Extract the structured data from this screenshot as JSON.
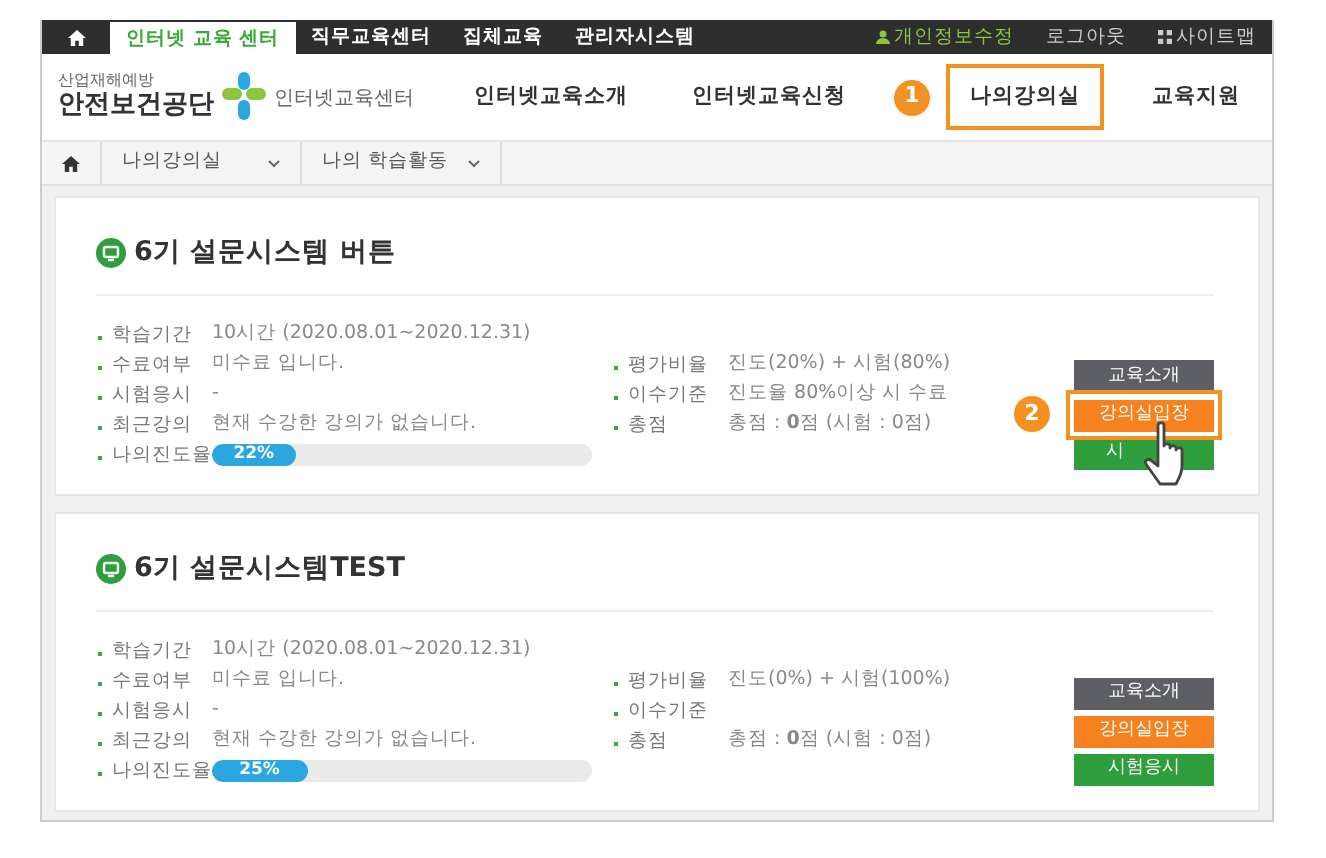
{
  "top_bar": {
    "tabs": [
      {
        "label": "인터넷 교육 센터",
        "selected": true
      },
      {
        "label": "직무교육센터",
        "selected": false
      },
      {
        "label": "집체교육",
        "selected": false
      },
      {
        "label": "관리자시스템",
        "selected": false
      }
    ],
    "links": [
      {
        "label": "개인정보수정",
        "kind": "user"
      },
      {
        "label": "로그아웃",
        "kind": "plain"
      },
      {
        "label": "사이트맵",
        "kind": "sitemap"
      }
    ]
  },
  "header": {
    "logo": {
      "tagline": "산업재해예방",
      "name": "안전보건공단",
      "subtitle": "인터넷교육센터"
    },
    "nav": [
      {
        "label": "인터넷교육소개"
      },
      {
        "label": "인터넷교육신청"
      },
      {
        "label": "나의강의실",
        "callout": "1"
      },
      {
        "label": "교육지원"
      }
    ]
  },
  "breadcrumb": [
    {
      "label": "나의강의실"
    },
    {
      "label": "나의 학습활동"
    }
  ],
  "courses": [
    {
      "title": "6기 설문시스템 버튼",
      "pointer_cursor": true,
      "details_left": [
        {
          "label": "학습기간",
          "value": "10시간 (2020.08.01~2020.12.31)"
        },
        {
          "label": "수료여부",
          "value": "미수료 입니다."
        },
        {
          "label": "시험응시",
          "value": "-"
        },
        {
          "label": "최근강의",
          "value": "현재 수강한 강의가 없습니다."
        },
        {
          "label": "나의진도율",
          "kind": "progress",
          "level": 0.22,
          "reading": "22%"
        }
      ],
      "details_right": [
        {
          "label": "평가비율",
          "value": "진도(20%) + 시험(80%)"
        },
        {
          "label": "이수기준",
          "value": "진도율 80%이상 시 수료"
        },
        {
          "label": "총점",
          "value": "총점 : **0**점 (시험 : 0점)"
        }
      ],
      "buttons": [
        {
          "label": "교육소개",
          "kind": "intro"
        },
        {
          "label": "강의실입장",
          "kind": "enter",
          "callout": "2"
        },
        {
          "label": "시",
          "kind": "exam"
        }
      ]
    },
    {
      "title": "6기 설문시스템TEST",
      "pointer_cursor": false,
      "details_left": [
        {
          "label": "학습기간",
          "value": "10시간 (2020.08.01~2020.12.31)"
        },
        {
          "label": "수료여부",
          "value": "미수료 입니다."
        },
        {
          "label": "시험응시",
          "value": "-"
        },
        {
          "label": "최근강의",
          "value": "현재 수강한 강의가 없습니다."
        },
        {
          "label": "나의진도율",
          "kind": "progress",
          "level": 0.25,
          "reading": "25%"
        }
      ],
      "details_right": [
        {
          "label": "평가비율",
          "value": "진도(0%) + 시험(100%)"
        },
        {
          "label": "이수기준"
        },
        {
          "label": "총점",
          "value": "총점 : **0**점 (시험 : 0점)"
        }
      ],
      "buttons": [
        {
          "label": "교육소개",
          "kind": "intro"
        },
        {
          "label": "강의실입장",
          "kind": "enter"
        },
        {
          "label": "시험응시",
          "kind": "exam"
        }
      ]
    }
  ]
}
